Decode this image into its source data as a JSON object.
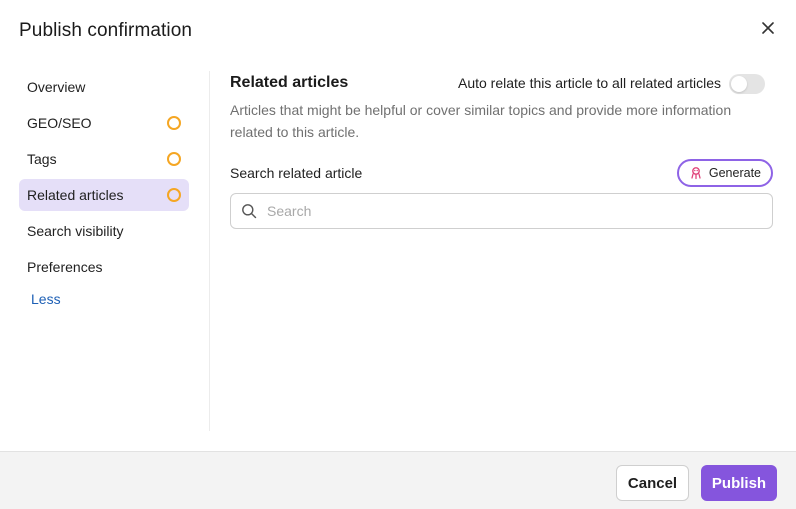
{
  "dialog": {
    "title": "Publish confirmation",
    "close_icon": "close-icon"
  },
  "sidebar": {
    "items": [
      {
        "label": "Overview",
        "status": null
      },
      {
        "label": "GEO/SEO",
        "status": "incomplete"
      },
      {
        "label": "Tags",
        "status": "incomplete"
      },
      {
        "label": "Related articles",
        "status": "incomplete",
        "active": true
      },
      {
        "label": "Search visibility",
        "status": null
      },
      {
        "label": "Preferences",
        "status": null
      }
    ],
    "less_label": "Less"
  },
  "main": {
    "section_title": "Related articles",
    "auto_relate_label": "Auto relate this article to all related articles",
    "auto_relate_enabled": false,
    "description": "Articles that might be helpful or cover similar topics and provide more information related to this article.",
    "search_label": "Search related article",
    "generate_label": "Generate",
    "generate_icon": "ai-bot-icon",
    "search_placeholder": "Search",
    "search_value": ""
  },
  "footer": {
    "cancel_label": "Cancel",
    "publish_label": "Publish"
  },
  "colors": {
    "accent": "#8555dd",
    "active_bg": "#e5dff8",
    "status_ring": "#f5a623",
    "link": "#1d5fb5",
    "generate_border": "#8e63e6",
    "generate_icon": "#e0457b"
  }
}
